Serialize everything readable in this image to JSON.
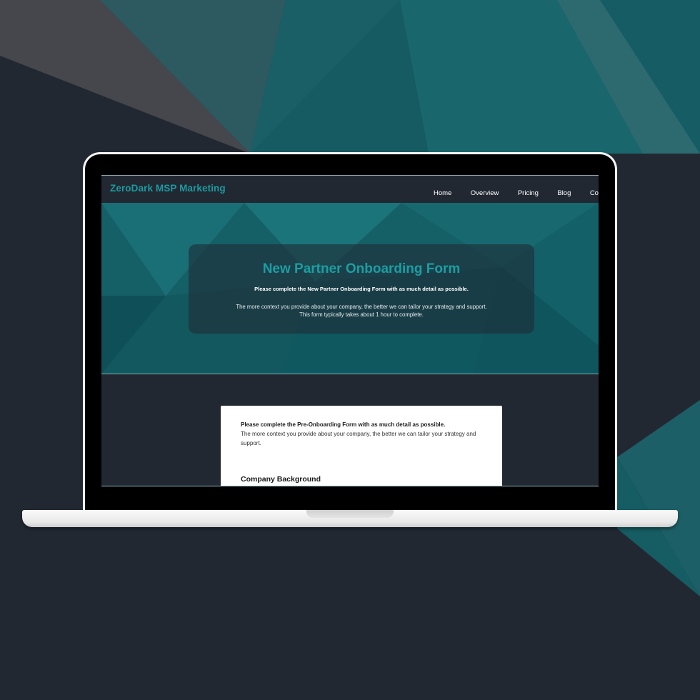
{
  "brand": "ZeroDark MSP Marketing",
  "nav": [
    "Home",
    "Overview",
    "Pricing",
    "Blog",
    "Contac"
  ],
  "hero": {
    "title": "New Partner Onboarding Form",
    "subtitle": "Please complete the New Partner Onboarding Form with as much detail as possible.",
    "body_line1": "The more context you provide about your company, the better we can tailor your strategy and support.",
    "body_line2": "This form typically takes about 1 hour to complete."
  },
  "form": {
    "intro_bold": "Please complete the Pre-Onboarding Form with as much detail as possible.",
    "intro": "The more context you provide about your company, the better we can tailor your strategy and support.",
    "section_heading": "Company Background"
  },
  "colors": {
    "accent": "#1c9ea3",
    "background": "#222832",
    "hero": "#155f66"
  }
}
